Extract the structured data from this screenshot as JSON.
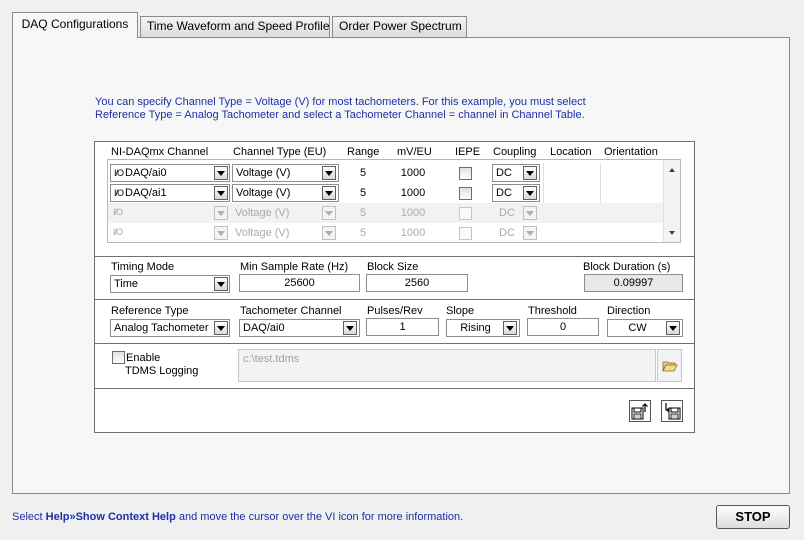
{
  "tabs": [
    {
      "label": "DAQ Configurations",
      "active": true
    },
    {
      "label": "Time Waveform and Speed Profile",
      "active": false
    },
    {
      "label": "Order Power Spectrum",
      "active": false
    }
  ],
  "info": {
    "line1": "You can specify Channel Type = Voltage (V) for most tachometers. For this example, you must select",
    "line2": "Reference Type = Analog Tachometer and select a Tachometer Channel = channel in Channel Table."
  },
  "channel_table": {
    "headers": {
      "channel": "NI-DAQmx Channel",
      "type": "Channel Type (EU)",
      "range": "Range",
      "mv": "mV/EU",
      "iepe": "IEPE",
      "coupling": "Coupling",
      "location": "Location",
      "orientation": "Orientation"
    },
    "rows": [
      {
        "channel": "DAQ/ai0",
        "type": "Voltage (V)",
        "range": "5",
        "mv": "1000",
        "iepe": false,
        "coupling": "DC",
        "location": "",
        "orientation": "",
        "enabled": true
      },
      {
        "channel": "DAQ/ai1",
        "type": "Voltage (V)",
        "range": "5",
        "mv": "1000",
        "iepe": false,
        "coupling": "DC",
        "location": "",
        "orientation": "",
        "enabled": true
      },
      {
        "channel": "",
        "type": "Voltage (V)",
        "range": "5",
        "mv": "1000",
        "iepe": false,
        "coupling": "DC",
        "location": "",
        "orientation": "",
        "enabled": false
      },
      {
        "channel": "",
        "type": "Voltage (V)",
        "range": "5",
        "mv": "1000",
        "iepe": false,
        "coupling": "DC",
        "location": "",
        "orientation": "",
        "enabled": false
      }
    ],
    "io_icon": "I/O"
  },
  "timing": {
    "mode_label": "Timing Mode",
    "mode_value": "Time",
    "rate_label": "Min Sample Rate (Hz)",
    "rate_value": "25600",
    "block_label": "Block Size",
    "block_value": "2560",
    "duration_label": "Block Duration (s)",
    "duration_value": "0.09997"
  },
  "reference": {
    "type_label": "Reference Type",
    "type_value": "Analog Tachometer",
    "tach_label": "Tachometer Channel",
    "tach_value": "DAQ/ai0",
    "pulses_label": "Pulses/Rev",
    "pulses_value": "1",
    "slope_label": "Slope",
    "slope_value": "Rising",
    "threshold_label": "Threshold",
    "threshold_value": "0",
    "direction_label": "Direction",
    "direction_value": "CW"
  },
  "tdms": {
    "enable_label_1": "Enable",
    "enable_label_2": "TDMS Logging",
    "enabled": false,
    "path_value": "c:\\test.tdms"
  },
  "icons": {
    "browse": "folder-open-icon",
    "load": "load-config-icon",
    "save": "save-config-icon"
  },
  "footer": {
    "help_prefix": "Select ",
    "help_bold": "Help»Show Context Help",
    "help_suffix": " and move the cursor over the VI  icon for more information."
  },
  "stop_label": "STOP",
  "colors": {
    "info_text": "#1c2fa8",
    "background": "#f0f0f0"
  }
}
